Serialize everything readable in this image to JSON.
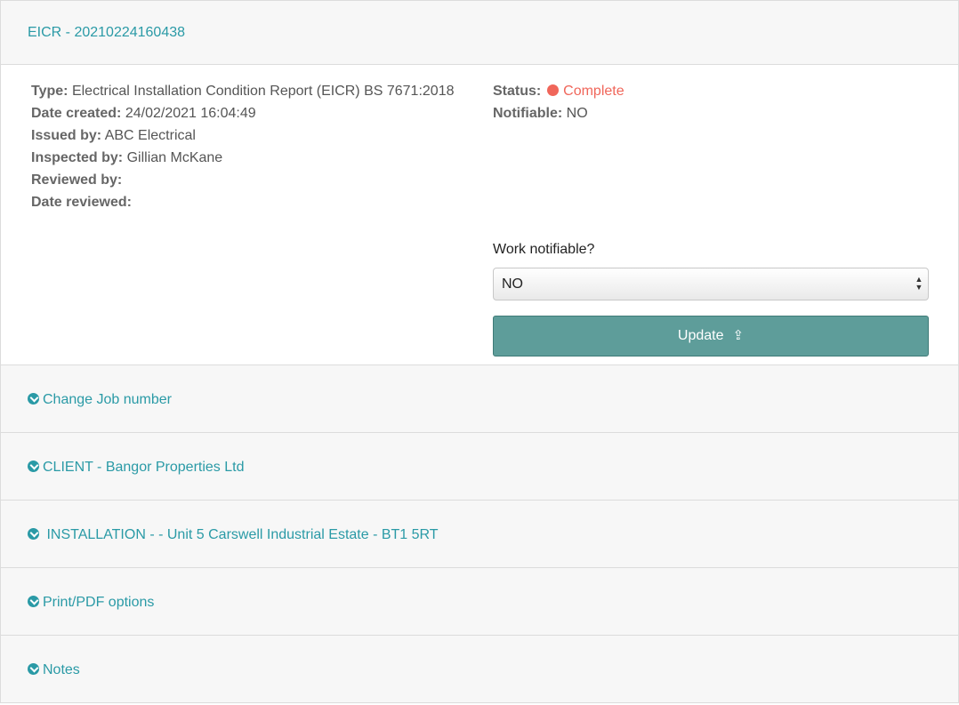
{
  "header": {
    "title": "EICR - 20210224160438"
  },
  "details_left": [
    {
      "label": "Type:",
      "value": "Electrical Installation Condition Report (EICR) BS 7671:2018"
    },
    {
      "label": "Date created:",
      "value": "24/02/2021 16:04:49"
    },
    {
      "label": "Issued by:",
      "value": "ABC Electrical"
    },
    {
      "label": "Inspected by:",
      "value": "Gillian McKane"
    },
    {
      "label": "Reviewed by:",
      "value": ""
    },
    {
      "label": "Date reviewed:",
      "value": ""
    }
  ],
  "details_right": {
    "status_label": "Status:",
    "status_value": "Complete",
    "status_color": "#f0665a",
    "notifiable_label": "Notifiable:",
    "notifiable_value": "NO"
  },
  "form": {
    "label": "Work notifiable?",
    "select_value": "NO",
    "button_label": "Update"
  },
  "sections": [
    {
      "label": "Change Job number",
      "icon": "circle-arrow-down-icon"
    },
    {
      "label": "CLIENT - Bangor Properties Ltd",
      "icon": "circle-arrow-down-icon"
    },
    {
      "label": " INSTALLATION - - Unit 5 Carswell Industrial Estate - BT1 5RT",
      "icon": "circle-arrow-down-icon"
    },
    {
      "label": "Print/PDF options",
      "icon": "circle-arrow-down-icon"
    },
    {
      "label": "Notes",
      "icon": "circle-arrow-down-icon"
    }
  ],
  "colors": {
    "accent": "#2a9aa6",
    "button": "#5e9d9a",
    "panel_bg": "#f7f7f7"
  }
}
